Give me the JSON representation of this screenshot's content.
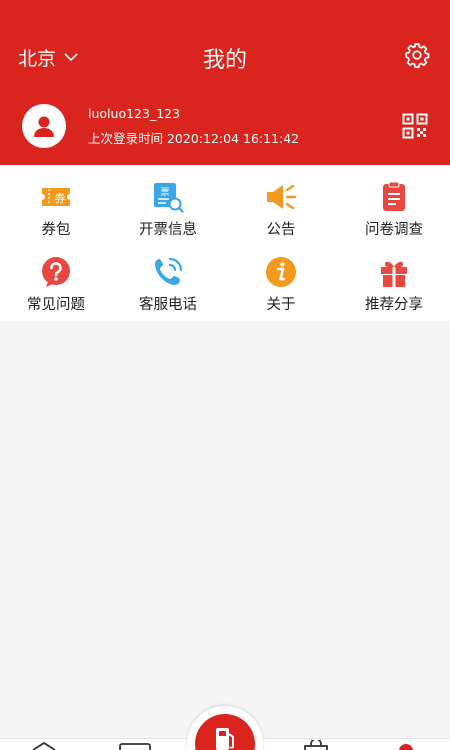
{
  "header": {
    "city": "北京",
    "title": "我的"
  },
  "user": {
    "username": "luoluo123_123",
    "last_login": "上次登录时间 2020:12:04 16:11:42"
  },
  "menu": [
    {
      "label": "券包",
      "icon": "coupon-icon",
      "color": "#f39a1e",
      "badge": "券"
    },
    {
      "label": "开票信息",
      "icon": "invoice-icon",
      "color": "#3aa6e8",
      "badge": "票"
    },
    {
      "label": "公告",
      "icon": "announcement-icon",
      "color": "#f39a1e"
    },
    {
      "label": "问卷调查",
      "icon": "survey-icon",
      "color": "#e9473f"
    },
    {
      "label": "常见问题",
      "icon": "faq-icon",
      "color": "#e9473f"
    },
    {
      "label": "客服电话",
      "icon": "phone-icon",
      "color": "#3aa6e8"
    },
    {
      "label": "关于",
      "icon": "about-icon",
      "color": "#f39a1e"
    },
    {
      "label": "推荐分享",
      "icon": "gift-icon",
      "color": "#e9473f"
    }
  ],
  "theme": {
    "brand_red": "#d9251d",
    "background": "#f5f5f5"
  },
  "bottom_nav": {
    "icons": [
      "home-icon",
      "card-icon",
      "fuel-icon",
      "shop-icon",
      "profile-icon"
    ]
  }
}
